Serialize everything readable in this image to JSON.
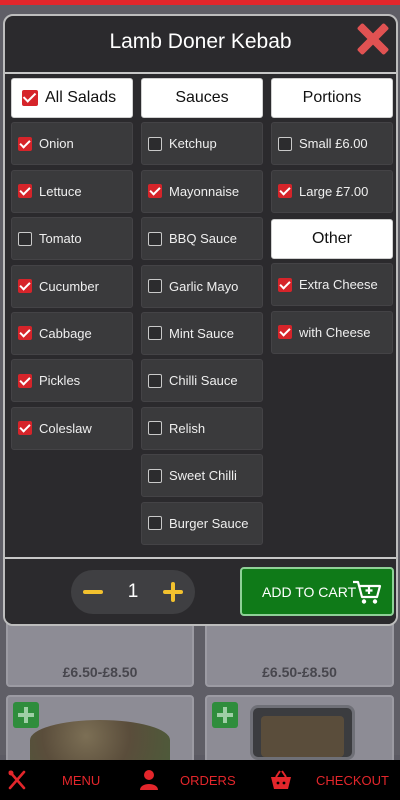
{
  "modal": {
    "title": "Lamb Doner Kebab",
    "columns": {
      "salads": {
        "header": "All Salads",
        "items": [
          {
            "label": "Onion",
            "checked": true
          },
          {
            "label": "Lettuce",
            "checked": true
          },
          {
            "label": "Tomato",
            "checked": false
          },
          {
            "label": "Cucumber",
            "checked": true
          },
          {
            "label": "Cabbage",
            "checked": true
          },
          {
            "label": "Pickles",
            "checked": true
          },
          {
            "label": "Coleslaw",
            "checked": true
          }
        ]
      },
      "sauces": {
        "header": "Sauces",
        "items": [
          {
            "label": "Ketchup",
            "checked": false
          },
          {
            "label": "Mayonnaise",
            "checked": true
          },
          {
            "label": "BBQ Sauce",
            "checked": false
          },
          {
            "label": "Garlic Mayo",
            "checked": false
          },
          {
            "label": "Mint Sauce",
            "checked": false
          },
          {
            "label": "Chilli Sauce",
            "checked": false
          },
          {
            "label": "Relish",
            "checked": false
          },
          {
            "label": "Sweet Chilli",
            "checked": false
          },
          {
            "label": "Burger Sauce",
            "checked": false
          }
        ]
      },
      "portions": {
        "header": "Portions",
        "items": [
          {
            "label": "Small £6.00",
            "checked": false
          },
          {
            "label": "Large £7.00",
            "checked": true
          }
        ]
      },
      "other": {
        "header": "Other",
        "items": [
          {
            "label": "Extra Cheese",
            "checked": true
          },
          {
            "label": "with Cheese",
            "checked": true
          }
        ]
      }
    },
    "quantity": "1",
    "add_to_cart_label": "ADD TO CART"
  },
  "background": {
    "prices": [
      "£6.50-£8.50",
      "£6.50-£8.50"
    ]
  },
  "bottom_nav": {
    "menu": "MENU",
    "orders": "ORDERS",
    "checkout": "CHECKOUT"
  },
  "colors": {
    "accent_red": "#e3262b",
    "checkbox_red": "#d6242a",
    "cart_green": "#0f7a18",
    "qty_yellow": "#f2c12e"
  }
}
